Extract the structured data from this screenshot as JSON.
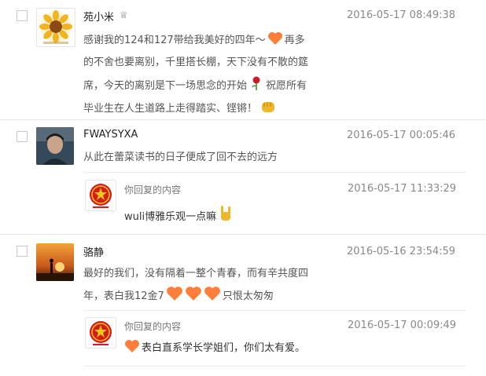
{
  "colors": {
    "heart": "#ff7f3a",
    "text": "#555555",
    "time": "#888888",
    "badge_red": "#d41c1c",
    "gold": "#f0b62a"
  },
  "comments": [
    {
      "name": "苑小米",
      "time": "2016-05-17 08:49:38",
      "lines": [
        "感谢我的124和127带给我美好的四年～",
        "再多",
        "的不舍也要离别，千里搭长棚，天下没有不散的筵",
        "席，今天的离别是下一场思念的开始",
        "祝愿所有",
        "毕业生在人生道路上走得踏实、铿锵！"
      ]
    },
    {
      "name": "FWAYSYXA",
      "time": "2016-05-17 00:05:46",
      "lines": [
        "从此在蕾菜读书的日子便成了回不去的远方"
      ],
      "reply": {
        "label": "你回复的内容",
        "time": "2016-05-17 11:33:29",
        "text": "wuli博雅乐观一点嘛"
      }
    },
    {
      "name": "骆静",
      "time": "2016-05-16 23:54:59",
      "lines": [
        "最好的我们，没有隔着一整个青春，而有辛共度四",
        "年，表白我12金7",
        "只恨太匆匆"
      ],
      "reply": {
        "label": "你回复的内容",
        "time": "2016-05-17 00:09:49",
        "text": "表白直系学长学姐们，你们太有爱。"
      }
    }
  ]
}
